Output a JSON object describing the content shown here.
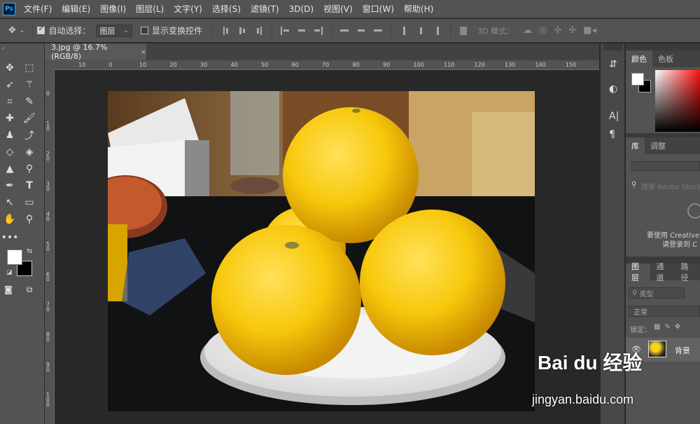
{
  "app": {
    "logo": "Ps"
  },
  "menu": [
    "文件(F)",
    "编辑(E)",
    "图像(I)",
    "图层(L)",
    "文字(Y)",
    "选择(S)",
    "滤镜(T)",
    "3D(D)",
    "视图(V)",
    "窗口(W)",
    "帮助(H)"
  ],
  "options": {
    "auto_select_label": "自动选择：",
    "auto_select_checked": true,
    "layer_select_value": "图层",
    "show_transform_label": "显示变换控件",
    "show_transform_checked": false,
    "mode_3d_label": "3D 模式："
  },
  "document": {
    "tab_title": "3.jpg @ 16.7%(RGB/8)",
    "close_glyph": "×",
    "ruler_top_labels": [
      "10",
      "0",
      "10",
      "20",
      "30",
      "40",
      "50",
      "60",
      "70",
      "80",
      "90",
      "100",
      "110",
      "120",
      "130",
      "140",
      "150"
    ],
    "ruler_left_labels": [
      "0",
      "1 0",
      "2 0",
      "3 0",
      "4 0",
      "5 0",
      "6 0",
      "7 0",
      "8 0",
      "9 0",
      "1 0 0"
    ]
  },
  "panels": {
    "color_tabs": [
      "颜色",
      "色板"
    ],
    "library_tabs": [
      "库",
      "调整"
    ],
    "library_search_placeholder": "搜索 Adobe Stock",
    "cc_line1": "要使用 Creative",
    "cc_line2": "请登录到 C",
    "layers_tabs": [
      "图层",
      "通道",
      "路径"
    ],
    "layer_filter": "类型",
    "blend_mode": "正常",
    "lock_label": "锁定：",
    "layer_name": "背景"
  },
  "watermark": {
    "logo_text": "Bai du 经验",
    "url": "jingyan.baidu.com"
  }
}
